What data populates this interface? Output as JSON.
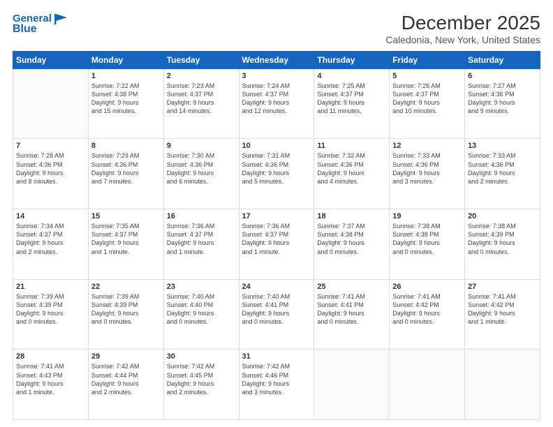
{
  "header": {
    "logo_line1": "General",
    "logo_line2": "Blue",
    "title": "December 2025",
    "subtitle": "Caledonia, New York, United States"
  },
  "days_of_week": [
    "Sunday",
    "Monday",
    "Tuesday",
    "Wednesday",
    "Thursday",
    "Friday",
    "Saturday"
  ],
  "weeks": [
    [
      {
        "day": "",
        "info": ""
      },
      {
        "day": "1",
        "info": "Sunrise: 7:22 AM\nSunset: 4:38 PM\nDaylight: 9 hours\nand 15 minutes."
      },
      {
        "day": "2",
        "info": "Sunrise: 7:23 AM\nSunset: 4:37 PM\nDaylight: 9 hours\nand 14 minutes."
      },
      {
        "day": "3",
        "info": "Sunrise: 7:24 AM\nSunset: 4:37 PM\nDaylight: 9 hours\nand 12 minutes."
      },
      {
        "day": "4",
        "info": "Sunrise: 7:25 AM\nSunset: 4:37 PM\nDaylight: 9 hours\nand 11 minutes."
      },
      {
        "day": "5",
        "info": "Sunrise: 7:26 AM\nSunset: 4:37 PM\nDaylight: 9 hours\nand 10 minutes."
      },
      {
        "day": "6",
        "info": "Sunrise: 7:27 AM\nSunset: 4:36 PM\nDaylight: 9 hours\nand 9 minutes."
      }
    ],
    [
      {
        "day": "7",
        "info": "Sunrise: 7:28 AM\nSunset: 4:36 PM\nDaylight: 9 hours\nand 8 minutes."
      },
      {
        "day": "8",
        "info": "Sunrise: 7:29 AM\nSunset: 4:36 PM\nDaylight: 9 hours\nand 7 minutes."
      },
      {
        "day": "9",
        "info": "Sunrise: 7:30 AM\nSunset: 4:36 PM\nDaylight: 9 hours\nand 6 minutes."
      },
      {
        "day": "10",
        "info": "Sunrise: 7:31 AM\nSunset: 4:36 PM\nDaylight: 9 hours\nand 5 minutes."
      },
      {
        "day": "11",
        "info": "Sunrise: 7:32 AM\nSunset: 4:36 PM\nDaylight: 9 hours\nand 4 minutes."
      },
      {
        "day": "12",
        "info": "Sunrise: 7:33 AM\nSunset: 4:36 PM\nDaylight: 9 hours\nand 3 minutes."
      },
      {
        "day": "13",
        "info": "Sunrise: 7:33 AM\nSunset: 4:36 PM\nDaylight: 9 hours\nand 2 minutes."
      }
    ],
    [
      {
        "day": "14",
        "info": "Sunrise: 7:34 AM\nSunset: 4:37 PM\nDaylight: 9 hours\nand 2 minutes."
      },
      {
        "day": "15",
        "info": "Sunrise: 7:35 AM\nSunset: 4:37 PM\nDaylight: 9 hours\nand 1 minute."
      },
      {
        "day": "16",
        "info": "Sunrise: 7:36 AM\nSunset: 4:37 PM\nDaylight: 9 hours\nand 1 minute."
      },
      {
        "day": "17",
        "info": "Sunrise: 7:36 AM\nSunset: 4:37 PM\nDaylight: 9 hours\nand 1 minute."
      },
      {
        "day": "18",
        "info": "Sunrise: 7:37 AM\nSunset: 4:38 PM\nDaylight: 9 hours\nand 0 minutes."
      },
      {
        "day": "19",
        "info": "Sunrise: 7:38 AM\nSunset: 4:38 PM\nDaylight: 9 hours\nand 0 minutes."
      },
      {
        "day": "20",
        "info": "Sunrise: 7:38 AM\nSunset: 4:39 PM\nDaylight: 9 hours\nand 0 minutes."
      }
    ],
    [
      {
        "day": "21",
        "info": "Sunrise: 7:39 AM\nSunset: 4:39 PM\nDaylight: 9 hours\nand 0 minutes."
      },
      {
        "day": "22",
        "info": "Sunrise: 7:39 AM\nSunset: 4:39 PM\nDaylight: 9 hours\nand 0 minutes."
      },
      {
        "day": "23",
        "info": "Sunrise: 7:40 AM\nSunset: 4:40 PM\nDaylight: 9 hours\nand 0 minutes."
      },
      {
        "day": "24",
        "info": "Sunrise: 7:40 AM\nSunset: 4:41 PM\nDaylight: 9 hours\nand 0 minutes."
      },
      {
        "day": "25",
        "info": "Sunrise: 7:41 AM\nSunset: 4:41 PM\nDaylight: 9 hours\nand 0 minutes."
      },
      {
        "day": "26",
        "info": "Sunrise: 7:41 AM\nSunset: 4:42 PM\nDaylight: 9 hours\nand 0 minutes."
      },
      {
        "day": "27",
        "info": "Sunrise: 7:41 AM\nSunset: 4:42 PM\nDaylight: 9 hours\nand 1 minute."
      }
    ],
    [
      {
        "day": "28",
        "info": "Sunrise: 7:41 AM\nSunset: 4:43 PM\nDaylight: 9 hours\nand 1 minute."
      },
      {
        "day": "29",
        "info": "Sunrise: 7:42 AM\nSunset: 4:44 PM\nDaylight: 9 hours\nand 2 minutes."
      },
      {
        "day": "30",
        "info": "Sunrise: 7:42 AM\nSunset: 4:45 PM\nDaylight: 9 hours\nand 2 minutes."
      },
      {
        "day": "31",
        "info": "Sunrise: 7:42 AM\nSunset: 4:46 PM\nDaylight: 9 hours\nand 3 minutes."
      },
      {
        "day": "",
        "info": ""
      },
      {
        "day": "",
        "info": ""
      },
      {
        "day": "",
        "info": ""
      }
    ]
  ]
}
